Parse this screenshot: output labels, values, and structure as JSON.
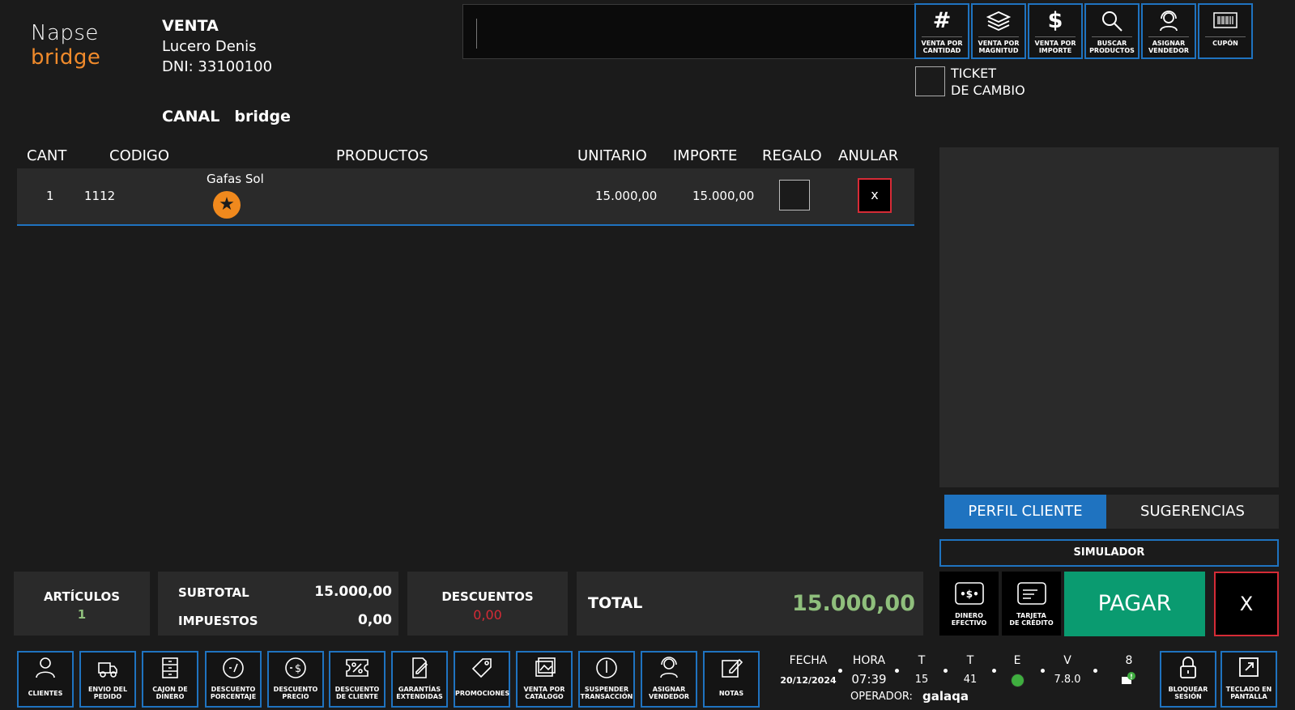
{
  "brand": {
    "logo_line1": "Napse",
    "logo_line2": "bridge"
  },
  "header": {
    "title": "VENTA",
    "customer_name": "Lucero Denis",
    "customer_dni": "DNI: 33100100",
    "canal_label": "CANAL",
    "canal_value": "bridge"
  },
  "search": {
    "value": ""
  },
  "toolbar": [
    {
      "label1": "VENTA POR",
      "label2": "CANTIDAD",
      "icon": "hash-icon"
    },
    {
      "label1": "VENTA POR",
      "label2": "MAGNITUD",
      "icon": "layers-icon"
    },
    {
      "label1": "VENTA POR",
      "label2": "IMPORTE",
      "icon": "dollar-icon"
    },
    {
      "label1": "BUSCAR",
      "label2": "PRODUCTOS",
      "icon": "search-icon"
    },
    {
      "label1": "ASIGNAR",
      "label2": "VENDEDOR",
      "icon": "headset-icon"
    },
    {
      "label1": "CUPÓN",
      "label2": "",
      "icon": "barcode-icon"
    }
  ],
  "ticket": {
    "line1": "TICKET",
    "line2": "DE CAMBIO"
  },
  "table": {
    "headers": [
      "CANT",
      "CODIGO",
      "PRODUCTOS",
      "UNITARIO",
      "IMPORTE",
      "REGALO",
      "ANULAR"
    ],
    "rows": [
      {
        "cant": "1",
        "codigo": "1112",
        "producto": "Gafas Sol",
        "unitario": "15.000,00",
        "importe": "15.000,00",
        "anular": "x"
      }
    ]
  },
  "side_tabs": {
    "perfil": "PERFIL CLIENTE",
    "sugerencias": "SUGERENCIAS",
    "simulador": "SIMULADOR"
  },
  "summary": {
    "articulos_label": "ARTÍCULOS",
    "articulos_value": "1",
    "subtotal_label": "SUBTOTAL",
    "subtotal_value": "15.000,00",
    "impuestos_label": "IMPUESTOS",
    "impuestos_value": "0,00",
    "descuentos_label": "DESCUENTOS",
    "descuentos_value": "0,00",
    "total_label": "TOTAL",
    "total_value": "15.000,00"
  },
  "payment": {
    "cash_l1": "DINERO",
    "cash_l2": "EFECTIVO",
    "card_l1": "TARJETA",
    "card_l2": "DE CRÉDITO",
    "pay": "PAGAR",
    "cancel": "X"
  },
  "bottom_toolbar": [
    {
      "label1": "CLIENTES",
      "label2": "",
      "icon": "user-icon"
    },
    {
      "label1": "ENVIO DEL",
      "label2": "PEDIDO",
      "icon": "truck-icon"
    },
    {
      "label1": "CAJON DE",
      "label2": "DINERO",
      "icon": "drawer-icon"
    },
    {
      "label1": "DESCUENTO",
      "label2": "PORCENTAJE",
      "icon": "percent-icon"
    },
    {
      "label1": "DESCUENTO",
      "label2": "PRECIO",
      "icon": "price-discount-icon"
    },
    {
      "label1": "DESCUENTO",
      "label2": "DE CLIENTE",
      "icon": "coupon-icon"
    },
    {
      "label1": "GARANTÍAS",
      "label2": "EXTENDIDAS",
      "icon": "warranty-icon"
    },
    {
      "label1": "PROMOCIONES",
      "label2": "",
      "icon": "tag-icon"
    },
    {
      "label1": "VENTA POR",
      "label2": "CATÁLOGO",
      "icon": "catalog-icon"
    },
    {
      "label1": "SUSPENDER",
      "label2": "TRANSACCIÓN",
      "icon": "clock-icon"
    },
    {
      "label1": "ASIGNAR",
      "label2": "VENDEDOR",
      "icon": "headset-icon"
    },
    {
      "label1": "NOTAS",
      "label2": "",
      "icon": "notes-icon"
    }
  ],
  "status": {
    "fecha_label": "FECHA",
    "fecha": "20/12/2024",
    "hora_label": "HORA",
    "hora": "07:39",
    "t1_label": "T",
    "t1": "15",
    "t2_label": "T",
    "t2": "41",
    "e_label": "E",
    "v_label": "V",
    "v": "7.8.0",
    "count": "8",
    "operador_label": "OPERADOR:",
    "operador": "galaqa"
  },
  "right_tools": [
    {
      "label1": "BLOQUEAR",
      "label2": "SESIÓN",
      "icon": "lock-icon"
    },
    {
      "label1": "TECLADO EN",
      "label2": "PANTALLA",
      "icon": "expand-icon"
    }
  ]
}
